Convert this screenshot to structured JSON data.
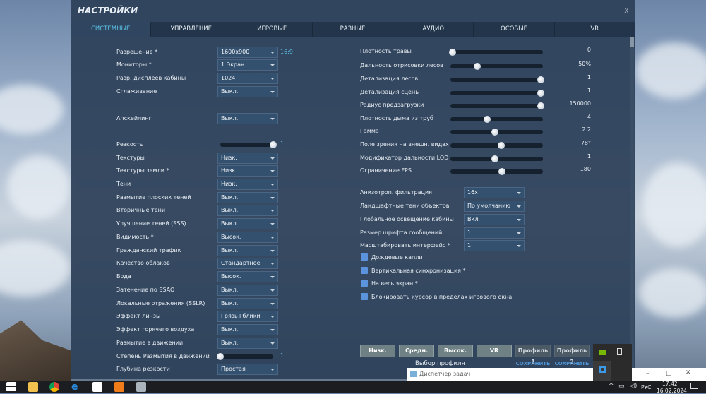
{
  "dialog": {
    "title": "НАСТРОЙКИ",
    "close": "X"
  },
  "tabs": [
    "СИСТЕМНЫЕ",
    "УПРАВЛЕНИЕ",
    "ИГРОВЫЕ",
    "РАЗНЫЕ",
    "АУДИО",
    "ОСОБЫЕ",
    "VR"
  ],
  "left_settings": [
    {
      "label": "Разрешение *",
      "type": "dropdown",
      "value": "1600x900",
      "extra": "16:9"
    },
    {
      "label": "Мониторы *",
      "type": "dropdown",
      "value": "1 Экран"
    },
    {
      "label": "Разр. дисплеев кабины",
      "type": "dropdown",
      "value": "1024"
    },
    {
      "label": "Сглаживание",
      "type": "dropdown",
      "value": "Выкл."
    },
    {
      "label": "Апскейлинг",
      "type": "dropdown",
      "value": "Выкл."
    },
    {
      "label": "Резкость",
      "type": "slider",
      "value": "1",
      "fraction": 1.0
    },
    {
      "label": "Текстуры",
      "type": "dropdown",
      "value": "Низк."
    },
    {
      "label": "Текстуры земли *",
      "type": "dropdown",
      "value": "Низк."
    },
    {
      "label": "Тени",
      "type": "dropdown",
      "value": "Низк."
    },
    {
      "label": "Размытие плоских теней",
      "type": "dropdown",
      "value": "Выкл."
    },
    {
      "label": "Вторичные тени",
      "type": "dropdown",
      "value": "Выкл."
    },
    {
      "label": "Улучшение теней (SSS)",
      "type": "dropdown",
      "value": "Выкл."
    },
    {
      "label": "Видимость *",
      "type": "dropdown",
      "value": "Высок."
    },
    {
      "label": "Гражданский трафик",
      "type": "dropdown",
      "value": "Выкл."
    },
    {
      "label": "Качество облаков",
      "type": "dropdown",
      "value": "Стандартное"
    },
    {
      "label": "Вода",
      "type": "dropdown",
      "value": "Высок."
    },
    {
      "label": "Затенение по SSAO",
      "type": "dropdown",
      "value": "Выкл."
    },
    {
      "label": "Локальные отражения (SSLR)",
      "type": "dropdown",
      "value": "Выкл."
    },
    {
      "label": "Эффект линзы",
      "type": "dropdown",
      "value": "Грязь+блики"
    },
    {
      "label": "Эффект горячего воздуха",
      "type": "dropdown",
      "value": "Выкл."
    },
    {
      "label": "Размытие в движении",
      "type": "dropdown",
      "value": "Выкл."
    },
    {
      "label": "Степень Размытия в движении",
      "type": "slider",
      "value": "1",
      "fraction": 0.0
    },
    {
      "label": "Глубина резкости",
      "type": "dropdown",
      "value": "Простая"
    }
  ],
  "right_sliders": [
    {
      "label": "Плотность травы",
      "value": "0",
      "fraction": 0.02
    },
    {
      "label": "Дальность отрисовки лесов",
      "value": "50%",
      "fraction": 0.29
    },
    {
      "label": "Детализация лесов",
      "value": "1",
      "fraction": 0.98
    },
    {
      "label": "Детализация сцены",
      "value": "1",
      "fraction": 0.98
    },
    {
      "label": "Радиус предзагрузки",
      "value": "150000",
      "fraction": 0.98
    },
    {
      "label": "Плотность дыма из труб",
      "value": "4",
      "fraction": 0.4
    },
    {
      "label": "Гамма",
      "value": "2.2",
      "fraction": 0.48
    },
    {
      "label": "Поле зрения на внешн. видах",
      "value": "78°",
      "fraction": 0.55
    },
    {
      "label": "Модификатор дальности LOD",
      "value": "1",
      "fraction": 0.48
    },
    {
      "label": "Ограничение FPS",
      "value": "180",
      "fraction": 0.56
    }
  ],
  "right_dropdowns": [
    {
      "label": "Анизотроп. фильтрация",
      "value": "16x"
    },
    {
      "label": "Ландшафтные тени объектов",
      "value": "По умолчанию"
    },
    {
      "label": "Глобальное освещение кабины",
      "value": "Вкл."
    },
    {
      "label": "Размер шрифта сообщений",
      "value": "1"
    },
    {
      "label": "Масштабировать интерфейс *",
      "value": "1"
    }
  ],
  "checkboxes": [
    {
      "label": "Дождевые капли",
      "checked": false
    },
    {
      "label": "Вертикальная синхронизация *",
      "checked": false
    },
    {
      "label": "На весь экран *",
      "checked": false
    },
    {
      "label": "Блокировать курсор в пределах игрового окна",
      "checked": false
    }
  ],
  "presets": {
    "buttons": [
      "Низк.",
      "Средн.",
      "Высок.",
      "VR"
    ],
    "caption": "Выбор профиля",
    "profiles": [
      "Профиль 1",
      "Профиль 2"
    ],
    "save": "СОХРАНИТЬ"
  },
  "taskbar": {
    "preview": "Диспетчер задач",
    "lang": "РУС",
    "time": "17:42",
    "date": "16.02.2024"
  },
  "colors": {
    "accent": "#5cc3e6",
    "checkbox": "#5b94dc"
  }
}
